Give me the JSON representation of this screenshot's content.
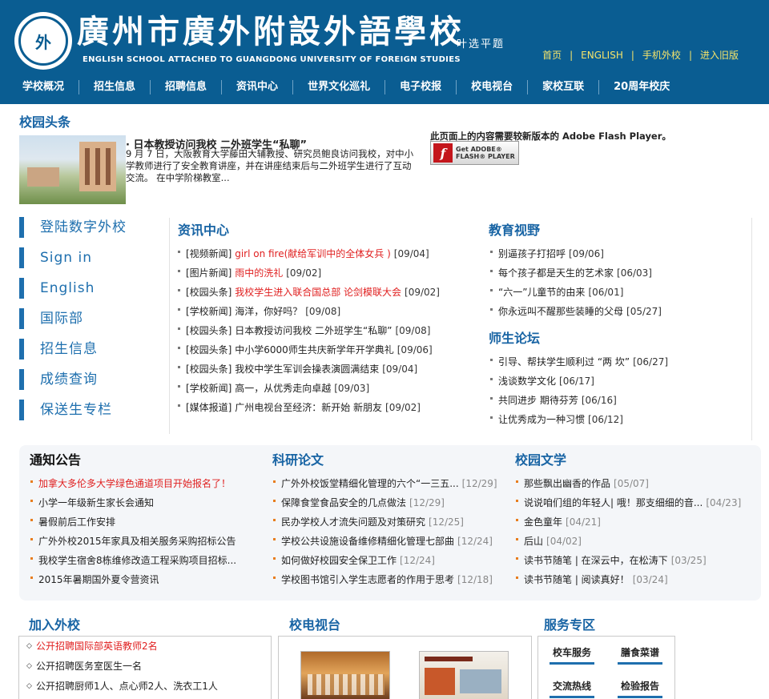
{
  "header": {
    "logo_text": "外",
    "school_name": "廣州市廣外附設外語學校",
    "school_name_en": "ENGLISH SCHOOL ATTACHED TO GUANGDONG UNIVERSITY OF FOREIGN STUDIES",
    "calligraphy": "叶选平题",
    "top_links": [
      "首页",
      "ENGLISH",
      "手机外校",
      "进入旧版"
    ]
  },
  "nav": [
    "学校概况",
    "招生信息",
    "招聘信息",
    "资讯中心",
    "世界文化巡礼",
    "电子校报",
    "校电视台",
    "家校互联",
    "20周年校庆"
  ],
  "headline": {
    "section_title": "校园头条",
    "title": "· 日本教授访问我校 二外班学生“私聊”",
    "body": "9 月 7 日，大阪教育大学藤田大辅教授、研究员鲍良访问我校，对中小学教师进行了安全教育讲座，并在讲座结束后与二外班学生进行了互动交流。 在中学阶梯教室...",
    "flash_message": "此页面上的内容需要较新版本的 Adobe Flash Player。",
    "flash_button": {
      "icon": "f",
      "line1": "Get ADOBE®",
      "line2": "FLASH® PLAYER"
    }
  },
  "left_menu": [
    "登陆数字外校",
    "Sign in",
    "English",
    "国际部",
    "招生信息",
    "成绩查询",
    "保送生专栏"
  ],
  "news_center": {
    "title": "资讯中心",
    "items": [
      {
        "category": "[视频新闻]",
        "text": "girl on fire(献给军训中的全体女兵 )",
        "date": "[09/04]",
        "red": true
      },
      {
        "category": "[图片新闻]",
        "text": "雨中的洗礼",
        "date": "[09/02]",
        "red": true
      },
      {
        "category": "[校园头条]",
        "text": "我校学生进入联合国总部 论剑模联大会",
        "date": "[09/02]",
        "red": true
      },
      {
        "category": "[学校新闻]",
        "text": "海洋，你好吗？",
        "date": "[09/08]",
        "red": false
      },
      {
        "category": "[校园头条]",
        "text": "日本教授访问我校 二外班学生“私聊”",
        "date": "[09/08]",
        "red": false
      },
      {
        "category": "[校园头条]",
        "text": "中小学6000师生共庆新学年开学典礼",
        "date": "[09/06]",
        "red": false
      },
      {
        "category": "[校园头条]",
        "text": "我校中学生军训会操表演圆满结束",
        "date": "[09/04]",
        "red": false
      },
      {
        "category": "[学校新闻]",
        "text": "高一，从优秀走向卓越",
        "date": "[09/03]",
        "red": false
      },
      {
        "category": "[媒体报道]",
        "text": "广州电视台至经济：新开始 新朋友",
        "date": "[09/02]",
        "red": false
      }
    ]
  },
  "edu_vision": {
    "title": "教育视野",
    "items": [
      {
        "text": "别逼孩子打招呼",
        "date": "[09/06]"
      },
      {
        "text": "每个孩子都是天生的艺术家",
        "date": "[06/03]"
      },
      {
        "text": "“六一”儿童节的由来",
        "date": "[06/01]"
      },
      {
        "text": "你永远叫不醒那些装睡的父母",
        "date": "[05/27]"
      }
    ]
  },
  "teacher_forum": {
    "title": "师生论坛",
    "items": [
      {
        "text": "引导、帮扶学生顺利过 “两 坎”",
        "date": "[06/27]"
      },
      {
        "text": "浅谈数学文化",
        "date": "[06/17]"
      },
      {
        "text": "共同进步 期待芬芳",
        "date": "[06/16]"
      },
      {
        "text": "让优秀成为一种习惯",
        "date": "[06/12]"
      }
    ]
  },
  "notices": {
    "title": "通知公告",
    "items": [
      {
        "text": "加拿大多伦多大学绿色通道项目开始报名了！",
        "red": true
      },
      {
        "text": "小学一年级新生家长会通知",
        "red": false
      },
      {
        "text": "暑假前后工作安排",
        "red": false
      },
      {
        "text": "广外外校2015年家具及相关服务采购招标公告",
        "red": false
      },
      {
        "text": "我校学生宿舍8栋维修改造工程采购项目招标...",
        "red": false
      },
      {
        "text": "2015年暑期国外夏令营资讯",
        "red": false
      }
    ]
  },
  "research": {
    "title": "科研论文",
    "items": [
      {
        "text": "广外外校饭堂精细化管理的六个“一三五...",
        "date": "[12/29]"
      },
      {
        "text": "保障食堂食品安全的几点做法",
        "date": "[12/29]"
      },
      {
        "text": "民办学校人才流失问题及对策研究",
        "date": "[12/25]"
      },
      {
        "text": "学校公共设施设备维修精细化管理七部曲",
        "date": "[12/24]"
      },
      {
        "text": "如何做好校园安全保卫工作",
        "date": "[12/24]"
      },
      {
        "text": "学校图书馆引入学生志愿者的作用于思考",
        "date": "[12/18]"
      }
    ]
  },
  "literature": {
    "title": "校园文学",
    "items": [
      {
        "text": "那些飘出幽香的作品",
        "date": "[05/07]"
      },
      {
        "text": "说说咱们组的年轻人| 哦！那支细细的音...",
        "date": "[04/23]"
      },
      {
        "text": "金色童年",
        "date": "[04/21]"
      },
      {
        "text": "后山",
        "date": "[04/02]"
      },
      {
        "text": "读书节随笔 | 在深云中，在松涛下",
        "date": "[03/25]"
      },
      {
        "text": "读书节随笔 | 阅读真好！",
        "date": "[03/24]"
      }
    ]
  },
  "join": {
    "title": "加入外校",
    "items": [
      {
        "text": "公开招聘国际部英语教师2名",
        "red": true
      },
      {
        "text": "公开招聘医务室医生一名",
        "red": false
      },
      {
        "text": "公开招聘厨师1人、点心师2人、洗衣工1人",
        "red": false
      }
    ]
  },
  "tv": {
    "title": "校电视台"
  },
  "services": {
    "title": "服务专区",
    "items": [
      "校车服务",
      "膳食菜谱",
      "交流热线",
      "检验报告"
    ]
  },
  "colors": {
    "header_bg": "#0a5d92",
    "accent_blue": "#1864a4",
    "link_yellow": "#f5e46a",
    "alert_red": "#e02020"
  }
}
